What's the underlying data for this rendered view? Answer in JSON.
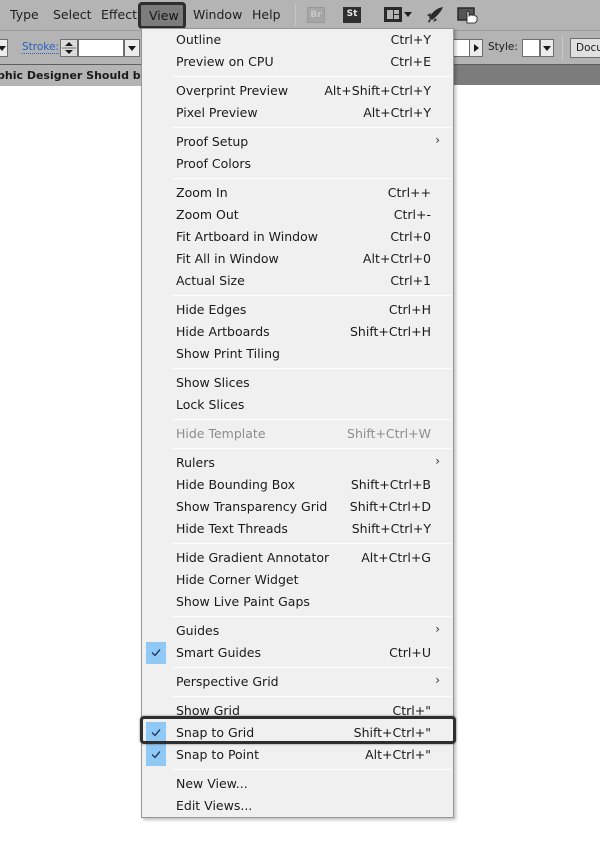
{
  "menubar": {
    "items": [
      {
        "label": "Type"
      },
      {
        "label": "Select"
      },
      {
        "label": "Effect"
      },
      {
        "label": "View"
      },
      {
        "label": "Window"
      },
      {
        "label": "Help"
      }
    ],
    "active": "View",
    "icons": {
      "bridge": "Br",
      "stock": "St"
    }
  },
  "controlbar": {
    "stroke_label": "Stroke:",
    "style_label": "Style:",
    "document_button": "Docu"
  },
  "document": {
    "tab_title": "phic Designer Should be Us"
  },
  "view_menu": {
    "groups": [
      [
        {
          "label": "Outline",
          "shortcut": "Ctrl+Y"
        },
        {
          "label": "Preview on CPU",
          "shortcut": "Ctrl+E"
        }
      ],
      [
        {
          "label": "Overprint Preview",
          "shortcut": "Alt+Shift+Ctrl+Y"
        },
        {
          "label": "Pixel Preview",
          "shortcut": "Alt+Ctrl+Y"
        }
      ],
      [
        {
          "label": "Proof Setup",
          "submenu": true
        },
        {
          "label": "Proof Colors"
        }
      ],
      [
        {
          "label": "Zoom In",
          "shortcut": "Ctrl++"
        },
        {
          "label": "Zoom Out",
          "shortcut": "Ctrl+-"
        },
        {
          "label": "Fit Artboard in Window",
          "shortcut": "Ctrl+0"
        },
        {
          "label": "Fit All in Window",
          "shortcut": "Alt+Ctrl+0"
        },
        {
          "label": "Actual Size",
          "shortcut": "Ctrl+1"
        }
      ],
      [
        {
          "label": "Hide Edges",
          "shortcut": "Ctrl+H"
        },
        {
          "label": "Hide Artboards",
          "shortcut": "Shift+Ctrl+H"
        },
        {
          "label": "Show Print Tiling"
        }
      ],
      [
        {
          "label": "Show Slices"
        },
        {
          "label": "Lock Slices"
        }
      ],
      [
        {
          "label": "Hide Template",
          "shortcut": "Shift+Ctrl+W",
          "disabled": true
        }
      ],
      [
        {
          "label": "Rulers",
          "submenu": true
        },
        {
          "label": "Hide Bounding Box",
          "shortcut": "Shift+Ctrl+B"
        },
        {
          "label": "Show Transparency Grid",
          "shortcut": "Shift+Ctrl+D"
        },
        {
          "label": "Hide Text Threads",
          "shortcut": "Shift+Ctrl+Y"
        }
      ],
      [
        {
          "label": "Hide Gradient Annotator",
          "shortcut": "Alt+Ctrl+G"
        },
        {
          "label": "Hide Corner Widget"
        },
        {
          "label": "Show Live Paint Gaps"
        }
      ],
      [
        {
          "label": "Guides",
          "submenu": true
        },
        {
          "label": "Smart Guides",
          "shortcut": "Ctrl+U",
          "checked": true
        }
      ],
      [
        {
          "label": "Perspective Grid",
          "submenu": true
        }
      ],
      [
        {
          "label": "Show Grid",
          "shortcut": "Ctrl+\""
        },
        {
          "label": "Snap to Grid",
          "shortcut": "Shift+Ctrl+\"",
          "checked": true,
          "highlighted": true
        },
        {
          "label": "Snap to Point",
          "shortcut": "Alt+Ctrl+\"",
          "checked": true
        }
      ],
      [
        {
          "label": "New View..."
        },
        {
          "label": "Edit Views..."
        }
      ]
    ]
  },
  "colors": {
    "menubar_bg": "#b4b4b4",
    "menu_bg": "#f0f0f0",
    "check_bg": "#90c8f6",
    "link_blue": "#2460c0",
    "disabled_text": "#8d8d8d"
  }
}
